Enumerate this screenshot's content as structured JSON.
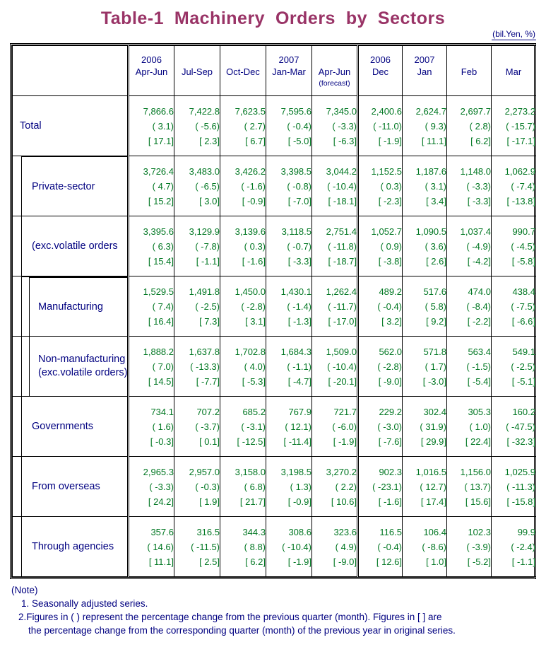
{
  "title": "Table-1  Machinery  Orders  by  Sectors",
  "unit_note": "(bil.Yen, %)",
  "colors": {
    "title": "#993366",
    "label_text": "#000080",
    "value_text": "#007722",
    "border": "#000000"
  },
  "header": {
    "blank_label": "",
    "columns": [
      {
        "year": "2006",
        "period": "Apr-Jun",
        "sub": ""
      },
      {
        "year": "",
        "period": "Jul-Sep",
        "sub": ""
      },
      {
        "year": "",
        "period": "Oct-Dec",
        "sub": ""
      },
      {
        "year": "2007",
        "period": "Jan-Mar",
        "sub": ""
      },
      {
        "year": "",
        "period": "Apr-Jun",
        "sub": "(forecast)"
      },
      {
        "year": "2006",
        "period": "Dec",
        "sub": ""
      },
      {
        "year": "2007",
        "period": "Jan",
        "sub": ""
      },
      {
        "year": "",
        "period": "Feb",
        "sub": ""
      },
      {
        "year": "",
        "period": "Mar",
        "sub": ""
      }
    ]
  },
  "rows": [
    {
      "label": "Total",
      "label2": "",
      "indent": 0,
      "cells": [
        {
          "value": "7,866.6",
          "qoq": "( 3.1)",
          "yoy": "[ 17.1]"
        },
        {
          "value": "7,422.8",
          "qoq": "( -5.6)",
          "yoy": "[ 2.3]"
        },
        {
          "value": "7,623.5",
          "qoq": "( 2.7)",
          "yoy": "[ 6.7]"
        },
        {
          "value": "7,595.6",
          "qoq": "( -0.4)",
          "yoy": "[ -5.0]"
        },
        {
          "value": "7,345.0",
          "qoq": "( -3.3)",
          "yoy": "[ -6.3]"
        },
        {
          "value": "2,400.6",
          "qoq": "( -11.0)",
          "yoy": "[ -1.9]"
        },
        {
          "value": "2,624.7",
          "qoq": "( 9.3)",
          "yoy": "[ 11.1]"
        },
        {
          "value": "2,697.7",
          "qoq": "( 2.8)",
          "yoy": "[ 6.2]"
        },
        {
          "value": "2,273.2",
          "qoq": "( -15.7)",
          "yoy": "[ -17.1]"
        }
      ]
    },
    {
      "label": "Private-sector",
      "label2": "",
      "indent": 1,
      "cells": [
        {
          "value": "3,726.4",
          "qoq": "(  4.7)",
          "yoy": "[ 15.2]"
        },
        {
          "value": "3,483.0",
          "qoq": "( -6.5)",
          "yoy": "[ 3.0]"
        },
        {
          "value": "3,426.2",
          "qoq": "( -1.6)",
          "yoy": "[ -0.9]"
        },
        {
          "value": "3,398.5",
          "qoq": "( -0.8)",
          "yoy": "[ -7.0]"
        },
        {
          "value": "3,044.2",
          "qoq": "( -10.4)",
          "yoy": "[ -18.1]"
        },
        {
          "value": "1,152.5",
          "qoq": "(  0.3)",
          "yoy": "[ -2.3]"
        },
        {
          "value": "1,187.6",
          "qoq": "(  3.1)",
          "yoy": "[ 3.4]"
        },
        {
          "value": "1,148.0",
          "qoq": "( -3.3)",
          "yoy": "[ -3.3]"
        },
        {
          "value": "1,062.9",
          "qoq": "( -7.4)",
          "yoy": "[ -13.8]"
        }
      ]
    },
    {
      "label": "(exc.volatile orders",
      "label2": "",
      "indent": 1,
      "cells": [
        {
          "value": "3,395.6",
          "qoq": "( 6.3)",
          "yoy": "[ 15.4]"
        },
        {
          "value": "3,129.9",
          "qoq": "( -7.8)",
          "yoy": "[ -1.1]"
        },
        {
          "value": "3,139.6",
          "qoq": "( 0.3)",
          "yoy": "[ -1.6]"
        },
        {
          "value": "3,118.5",
          "qoq": "( -0.7)",
          "yoy": "[ -3.3]"
        },
        {
          "value": "2,751.4",
          "qoq": "( -11.8)",
          "yoy": "[ -18.7]"
        },
        {
          "value": "1,052.7",
          "qoq": "( 0.9)",
          "yoy": "[ -3.8]"
        },
        {
          "value": "1,090.5",
          "qoq": "( 3.6)",
          "yoy": "[ 2.6]"
        },
        {
          "value": "1,037.4",
          "qoq": "( -4.9)",
          "yoy": "[ -4.2]"
        },
        {
          "value": "990.7",
          "qoq": "( -4.5)",
          "yoy": "[ -5.8]"
        }
      ]
    },
    {
      "label": "Manufacturing",
      "label2": "",
      "indent": 2,
      "cells": [
        {
          "value": "1,529.5",
          "qoq": "( 7.4)",
          "yoy": "[ 16.4]"
        },
        {
          "value": "1,491.8",
          "qoq": "( -2.5)",
          "yoy": "[ 7.3]"
        },
        {
          "value": "1,450.0",
          "qoq": "( -2.8)",
          "yoy": "[ 3.1]"
        },
        {
          "value": "1,430.1",
          "qoq": "( -1.4)",
          "yoy": "[ -1.3]"
        },
        {
          "value": "1,262.4",
          "qoq": "( -11.7)",
          "yoy": "[ -17.0]"
        },
        {
          "value": "489.2",
          "qoq": "( -0.4)",
          "yoy": "[ 3.2]"
        },
        {
          "value": "517.6",
          "qoq": "( 5.8)",
          "yoy": "[ 9.2]"
        },
        {
          "value": "474.0",
          "qoq": "( -8.4)",
          "yoy": "[ -2.2]"
        },
        {
          "value": "438.4",
          "qoq": "( -7.5)",
          "yoy": "[ -6.6]"
        }
      ]
    },
    {
      "label": "Non-manufacturing",
      "label2": "(exc.volatile orders)",
      "indent": 2,
      "cells": [
        {
          "value": "1,888.2",
          "qoq": "( 7.0)",
          "yoy": "[ 14.5]"
        },
        {
          "value": "1,637.8",
          "qoq": "( -13.3)",
          "yoy": "[ -7.7]"
        },
        {
          "value": "1,702.8",
          "qoq": "( 4.0)",
          "yoy": "[ -5.3]"
        },
        {
          "value": "1,684.3",
          "qoq": "( -1.1)",
          "yoy": "[ -4.7]"
        },
        {
          "value": "1,509.0",
          "qoq": "( -10.4)",
          "yoy": "[ -20.1]"
        },
        {
          "value": "562.0",
          "qoq": "( -2.8)",
          "yoy": "[ -9.0]"
        },
        {
          "value": "571.8",
          "qoq": "( 1.7)",
          "yoy": "[ -3.0]"
        },
        {
          "value": "563.4",
          "qoq": "( -1.5)",
          "yoy": "[ -5.4]"
        },
        {
          "value": "549.1",
          "qoq": "( -2.5)",
          "yoy": "[ -5.1]"
        }
      ]
    },
    {
      "label": "Governments",
      "label2": "",
      "indent": 1,
      "cells": [
        {
          "value": "734.1",
          "qoq": "( 1.6)",
          "yoy": "[ -0.3]"
        },
        {
          "value": "707.2",
          "qoq": "( -3.7)",
          "yoy": "[ 0.1]"
        },
        {
          "value": "685.2",
          "qoq": "( -3.1)",
          "yoy": "[ -12.5]"
        },
        {
          "value": "767.9",
          "qoq": "( 12.1)",
          "yoy": "[ -11.4]"
        },
        {
          "value": "721.7",
          "qoq": "( -6.0)",
          "yoy": "[ -1.9]"
        },
        {
          "value": "229.2",
          "qoq": "( -3.0)",
          "yoy": "[ -7.6]"
        },
        {
          "value": "302.4",
          "qoq": "( 31.9)",
          "yoy": "[ 29.9]"
        },
        {
          "value": "305.3",
          "qoq": "( 1.0)",
          "yoy": "[ 22.4]"
        },
        {
          "value": "160.2",
          "qoq": "( -47.5)",
          "yoy": "[ -32.3]"
        }
      ]
    },
    {
      "label": "From overseas",
      "label2": "",
      "indent": 1,
      "cells": [
        {
          "value": "2,965.3",
          "qoq": "( -3.3)",
          "yoy": "[ 24.2]"
        },
        {
          "value": "2,957.0",
          "qoq": "( -0.3)",
          "yoy": "[ 1.9]"
        },
        {
          "value": "3,158.0",
          "qoq": "( 6.8)",
          "yoy": "[ 21.7]"
        },
        {
          "value": "3,198.5",
          "qoq": "( 1.3)",
          "yoy": "[ -0.9]"
        },
        {
          "value": "3,270.2",
          "qoq": "( 2.2)",
          "yoy": "[ 10.6]"
        },
        {
          "value": "902.3",
          "qoq": "( -23.1)",
          "yoy": "[ -1.6]"
        },
        {
          "value": "1,016.5",
          "qoq": "( 12.7)",
          "yoy": "[ 17.4]"
        },
        {
          "value": "1,156.0",
          "qoq": "( 13.7)",
          "yoy": "[ 15.6]"
        },
        {
          "value": "1,025.9",
          "qoq": "( -11.3)",
          "yoy": "[ -15.8]"
        }
      ]
    },
    {
      "label": "Through agencies",
      "label2": "",
      "indent": 1,
      "cells": [
        {
          "value": "357.6",
          "qoq": "( 14.6)",
          "yoy": "[ 11.1]"
        },
        {
          "value": "316.5",
          "qoq": "( -11.5)",
          "yoy": "[ 2.5]"
        },
        {
          "value": "344.3",
          "qoq": "( 8.8)",
          "yoy": "[ 6.2]"
        },
        {
          "value": "308.6",
          "qoq": "( -10.4)",
          "yoy": "[ -1.9]"
        },
        {
          "value": "323.6",
          "qoq": "( 4.9)",
          "yoy": "[ -9.0]"
        },
        {
          "value": "116.5",
          "qoq": "( -0.4)",
          "yoy": "[ 12.6]"
        },
        {
          "value": "106.4",
          "qoq": "( -8.6)",
          "yoy": "[ 1.0]"
        },
        {
          "value": "102.3",
          "qoq": "( -3.9)",
          "yoy": "[ -5.2]"
        },
        {
          "value": "99.9",
          "qoq": "( -2.4)",
          "yoy": "[ -1.1]"
        }
      ]
    }
  ],
  "notes": {
    "heading": "(Note)",
    "line1": "1. Seasonally adjusted series.",
    "line2": "2.Figures in ( ) represent the percentage change from the previous quarter (month). Figures in [ ] are",
    "line3": "the percentage change from the corresponding quarter (month) of the previous year in original series."
  }
}
